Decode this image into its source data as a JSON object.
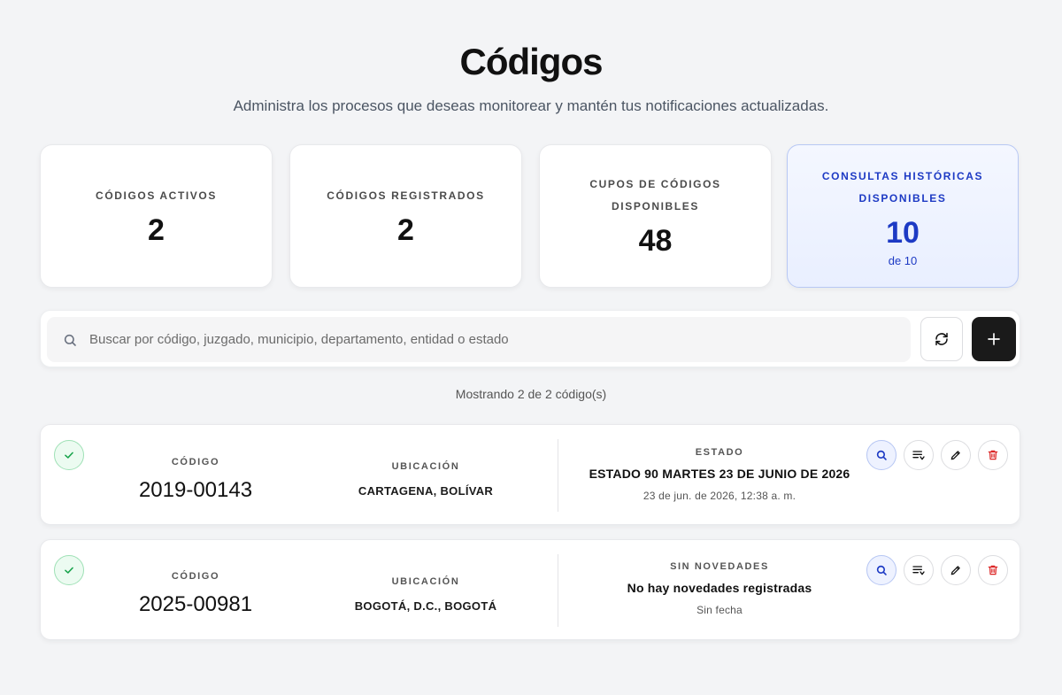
{
  "header": {
    "title": "Códigos",
    "subtitle": "Administra los procesos que deseas monitorear y mantén tus notificaciones actualizadas."
  },
  "stats": [
    {
      "label": "CÓDIGOS ACTIVOS",
      "value": "2"
    },
    {
      "label": "CÓDIGOS REGISTRADOS",
      "value": "2"
    },
    {
      "label": "CUPOS DE CÓDIGOS DISPONIBLES",
      "value": "48"
    },
    {
      "label": "CONSULTAS HISTÓRICAS DISPONIBLES",
      "value": "10",
      "sub": "de 10"
    }
  ],
  "search": {
    "placeholder": "Buscar por código, juzgado, municipio, departamento, entidad o estado",
    "value": ""
  },
  "showing": "Mostrando 2 de 2 código(s)",
  "codes": [
    {
      "code_label": "CÓDIGO",
      "code": "2019-00143",
      "location_label": "UBICACIÓN",
      "location": "CARTAGENA, BOLÍVAR",
      "status_label": "ESTADO",
      "status_main": "ESTADO 90 MARTES 23 DE JUNIO DE 2026",
      "status_date": "23 de jun. de 2026, 12:38 a. m."
    },
    {
      "code_label": "CÓDIGO",
      "code": "2025-00981",
      "location_label": "UBICACIÓN",
      "location": "BOGOTÁ, D.C., BOGOTÁ",
      "status_label": "SIN NOVEDADES",
      "status_main": "No hay novedades registradas",
      "status_date": "Sin fecha"
    }
  ],
  "icons": {
    "search": "search-icon",
    "refresh": "refresh-icon",
    "add": "plus-icon",
    "check": "check-icon",
    "view": "search-icon",
    "list": "list-icon",
    "edit": "pencil-icon",
    "delete": "trash-icon"
  },
  "colors": {
    "accent_blue": "#1d3ac4",
    "success_green": "#16a34a",
    "danger_red": "#dc2626",
    "primary_dark": "#1a1a1a"
  }
}
